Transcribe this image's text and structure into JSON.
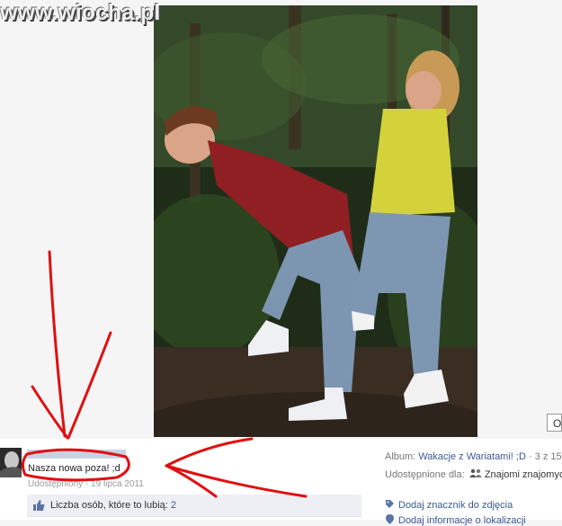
{
  "watermark": "www.wiocha.pl",
  "photo": {
    "alt": "two girls posing in a forest"
  },
  "options_button": {
    "glyph": "O"
  },
  "post": {
    "caption": "Nasza nowa poza! ;d",
    "shared_prefix": "Udostępniony",
    "date": "19 lipca 2011",
    "likes_label": "Liczba osób, które to lubią:",
    "likes_count": "2"
  },
  "album": {
    "label": "Album:",
    "name": "Wakacje z Wariatami! ;D",
    "position": "· 3 z 15"
  },
  "shared_with": {
    "label": "Udostępnione dla:",
    "value": "Znajomi znajomych"
  },
  "actions": {
    "tag_photo": "Dodaj znacznik do zdjęcia",
    "add_location": "Dodaj informacje o lokalizacji"
  },
  "colors": {
    "link": "#3b5998",
    "annotation": "#e01010",
    "likes_bg": "#edeff4"
  },
  "icons": [
    "like-icon",
    "tag-icon",
    "people-icon",
    "location-icon"
  ]
}
